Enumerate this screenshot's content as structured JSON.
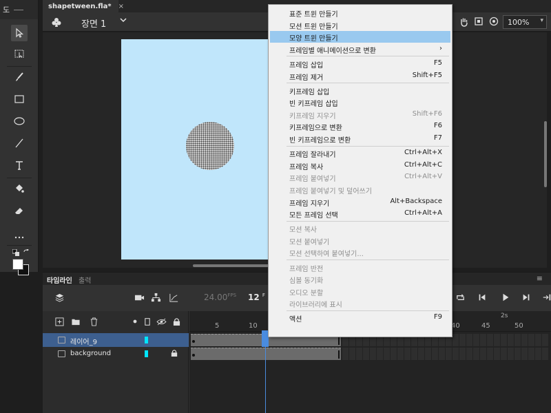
{
  "tools_panel": {
    "title": "도"
  },
  "document": {
    "tab_title": "shapetween.fla*",
    "close_glyph": "×"
  },
  "stage_bar": {
    "scene_label": "장면 1",
    "zoom": "100%"
  },
  "timeline": {
    "tabs": [
      "타임라인",
      "출력"
    ],
    "fps": "24.00",
    "fps_unit": "FPS",
    "current_frame": "12",
    "current_frame_unit": "F",
    "ruler_labels": [
      "5",
      "10",
      "40",
      "45",
      "50"
    ],
    "time_marker": "2s",
    "layers": [
      {
        "name": "레이어_9",
        "color": "#00e5ff",
        "selected": true,
        "locked": false
      },
      {
        "name": "background",
        "color": "#00e5ff",
        "selected": false,
        "locked": true
      }
    ]
  },
  "context_menu": {
    "sections": [
      {
        "items": [
          {
            "label": "표준 트윈 만들기",
            "shortcut": "",
            "disabled": false,
            "highlighted": false
          },
          {
            "label": "모션 트윈 만들기",
            "shortcut": "",
            "disabled": false,
            "highlighted": false
          },
          {
            "label": "모양 트윈 만들기",
            "shortcut": "",
            "disabled": false,
            "highlighted": true
          },
          {
            "label": "프레임별 애니메이션으로 변환",
            "shortcut": "",
            "disabled": false,
            "highlighted": false,
            "submenu": "›"
          }
        ]
      },
      {
        "items": [
          {
            "label": "프레임 삽입",
            "shortcut": "F5",
            "disabled": false,
            "highlighted": false
          },
          {
            "label": "프레임 제거",
            "shortcut": "Shift+F5",
            "disabled": false,
            "highlighted": false
          }
        ]
      },
      {
        "items": [
          {
            "label": "키프레임 삽입",
            "shortcut": "",
            "disabled": false,
            "highlighted": false
          },
          {
            "label": "빈 키프레임 삽입",
            "shortcut": "",
            "disabled": false,
            "highlighted": false
          },
          {
            "label": "키프레임 지우기",
            "shortcut": "Shift+F6",
            "disabled": true,
            "highlighted": false
          },
          {
            "label": "키프레임으로 변환",
            "shortcut": "F6",
            "disabled": false,
            "highlighted": false
          },
          {
            "label": "빈 키프레임으로 변환",
            "shortcut": "F7",
            "disabled": false,
            "highlighted": false
          }
        ]
      },
      {
        "items": [
          {
            "label": "프레임 잘라내기",
            "shortcut": "Ctrl+Alt+X",
            "disabled": false,
            "highlighted": false
          },
          {
            "label": "프레임 복사",
            "shortcut": "Ctrl+Alt+C",
            "disabled": false,
            "highlighted": false
          },
          {
            "label": "프레임 붙여넣기",
            "shortcut": "Ctrl+Alt+V",
            "disabled": true,
            "highlighted": false
          },
          {
            "label": "프레임 붙여넣기 및 덮어쓰기",
            "shortcut": "",
            "disabled": true,
            "highlighted": false
          },
          {
            "label": "프레임 지우기",
            "shortcut": "Alt+Backspace",
            "disabled": false,
            "highlighted": false
          },
          {
            "label": "모든 프레임 선택",
            "shortcut": "Ctrl+Alt+A",
            "disabled": false,
            "highlighted": false
          }
        ]
      },
      {
        "items": [
          {
            "label": "모션 복사",
            "shortcut": "",
            "disabled": true,
            "highlighted": false
          },
          {
            "label": "모션 붙여넣기",
            "shortcut": "",
            "disabled": true,
            "highlighted": false
          },
          {
            "label": "모션 선택하여 붙여넣기...",
            "shortcut": "",
            "disabled": true,
            "highlighted": false
          }
        ]
      },
      {
        "items": [
          {
            "label": "프레임 반전",
            "shortcut": "",
            "disabled": true,
            "highlighted": false
          },
          {
            "label": "심볼 동기화",
            "shortcut": "",
            "disabled": true,
            "highlighted": false
          },
          {
            "label": "오디오 분할",
            "shortcut": "",
            "disabled": true,
            "highlighted": false
          },
          {
            "label": "라이브러리에 표시",
            "shortcut": "",
            "disabled": true,
            "highlighted": false
          }
        ]
      },
      {
        "items": [
          {
            "label": "액션",
            "shortcut": "F9",
            "disabled": false,
            "highlighted": false
          }
        ]
      }
    ]
  },
  "colors": {
    "stage_bg": "#c0e6fb",
    "menu_highlight": "#99c9ef",
    "selected_layer": "#3d5f8f",
    "playhead": "#4a8ce0"
  }
}
